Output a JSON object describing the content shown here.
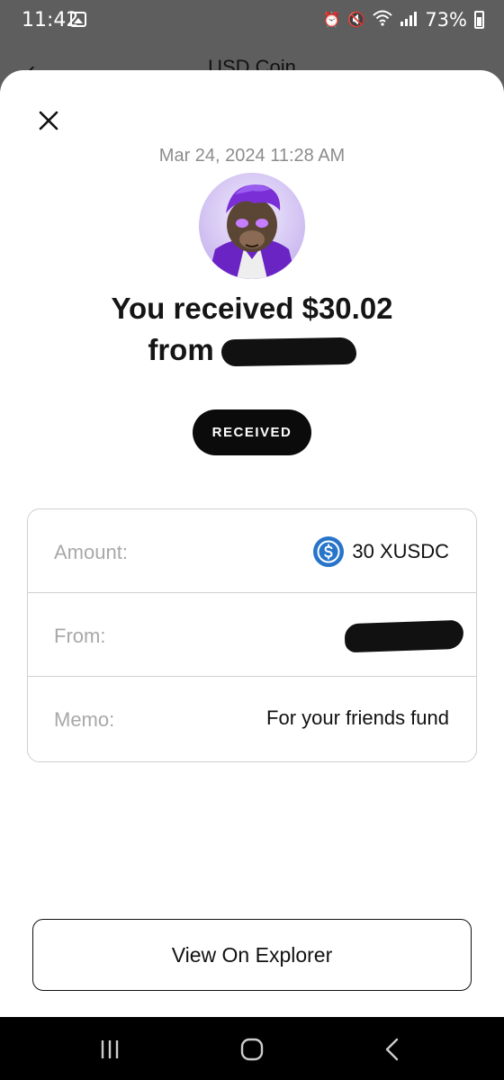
{
  "status_bar": {
    "time": "11:42",
    "battery": "73%",
    "icons": [
      "gallery-icon",
      "alarm-icon",
      "mute-icon",
      "wifi-icon",
      "signal-icon",
      "battery-icon"
    ]
  },
  "background_page": {
    "title": "USD Coin"
  },
  "transaction": {
    "date": "Mar 24, 2024 11:28 AM",
    "headline": "You received $30.02",
    "from_prefix": "from",
    "status": "RECEIVED",
    "details": {
      "amount_label": "Amount:",
      "amount_value": "30 XUSDC",
      "from_label": "From:",
      "memo_label": "Memo:",
      "memo_value": "For your friends fund"
    }
  },
  "actions": {
    "explorer_label": "View On Explorer"
  },
  "colors": {
    "accent_usdc": "#2775CA",
    "pill_bg": "#0B0B0B",
    "avatar_purple": "#7B2FD0"
  }
}
